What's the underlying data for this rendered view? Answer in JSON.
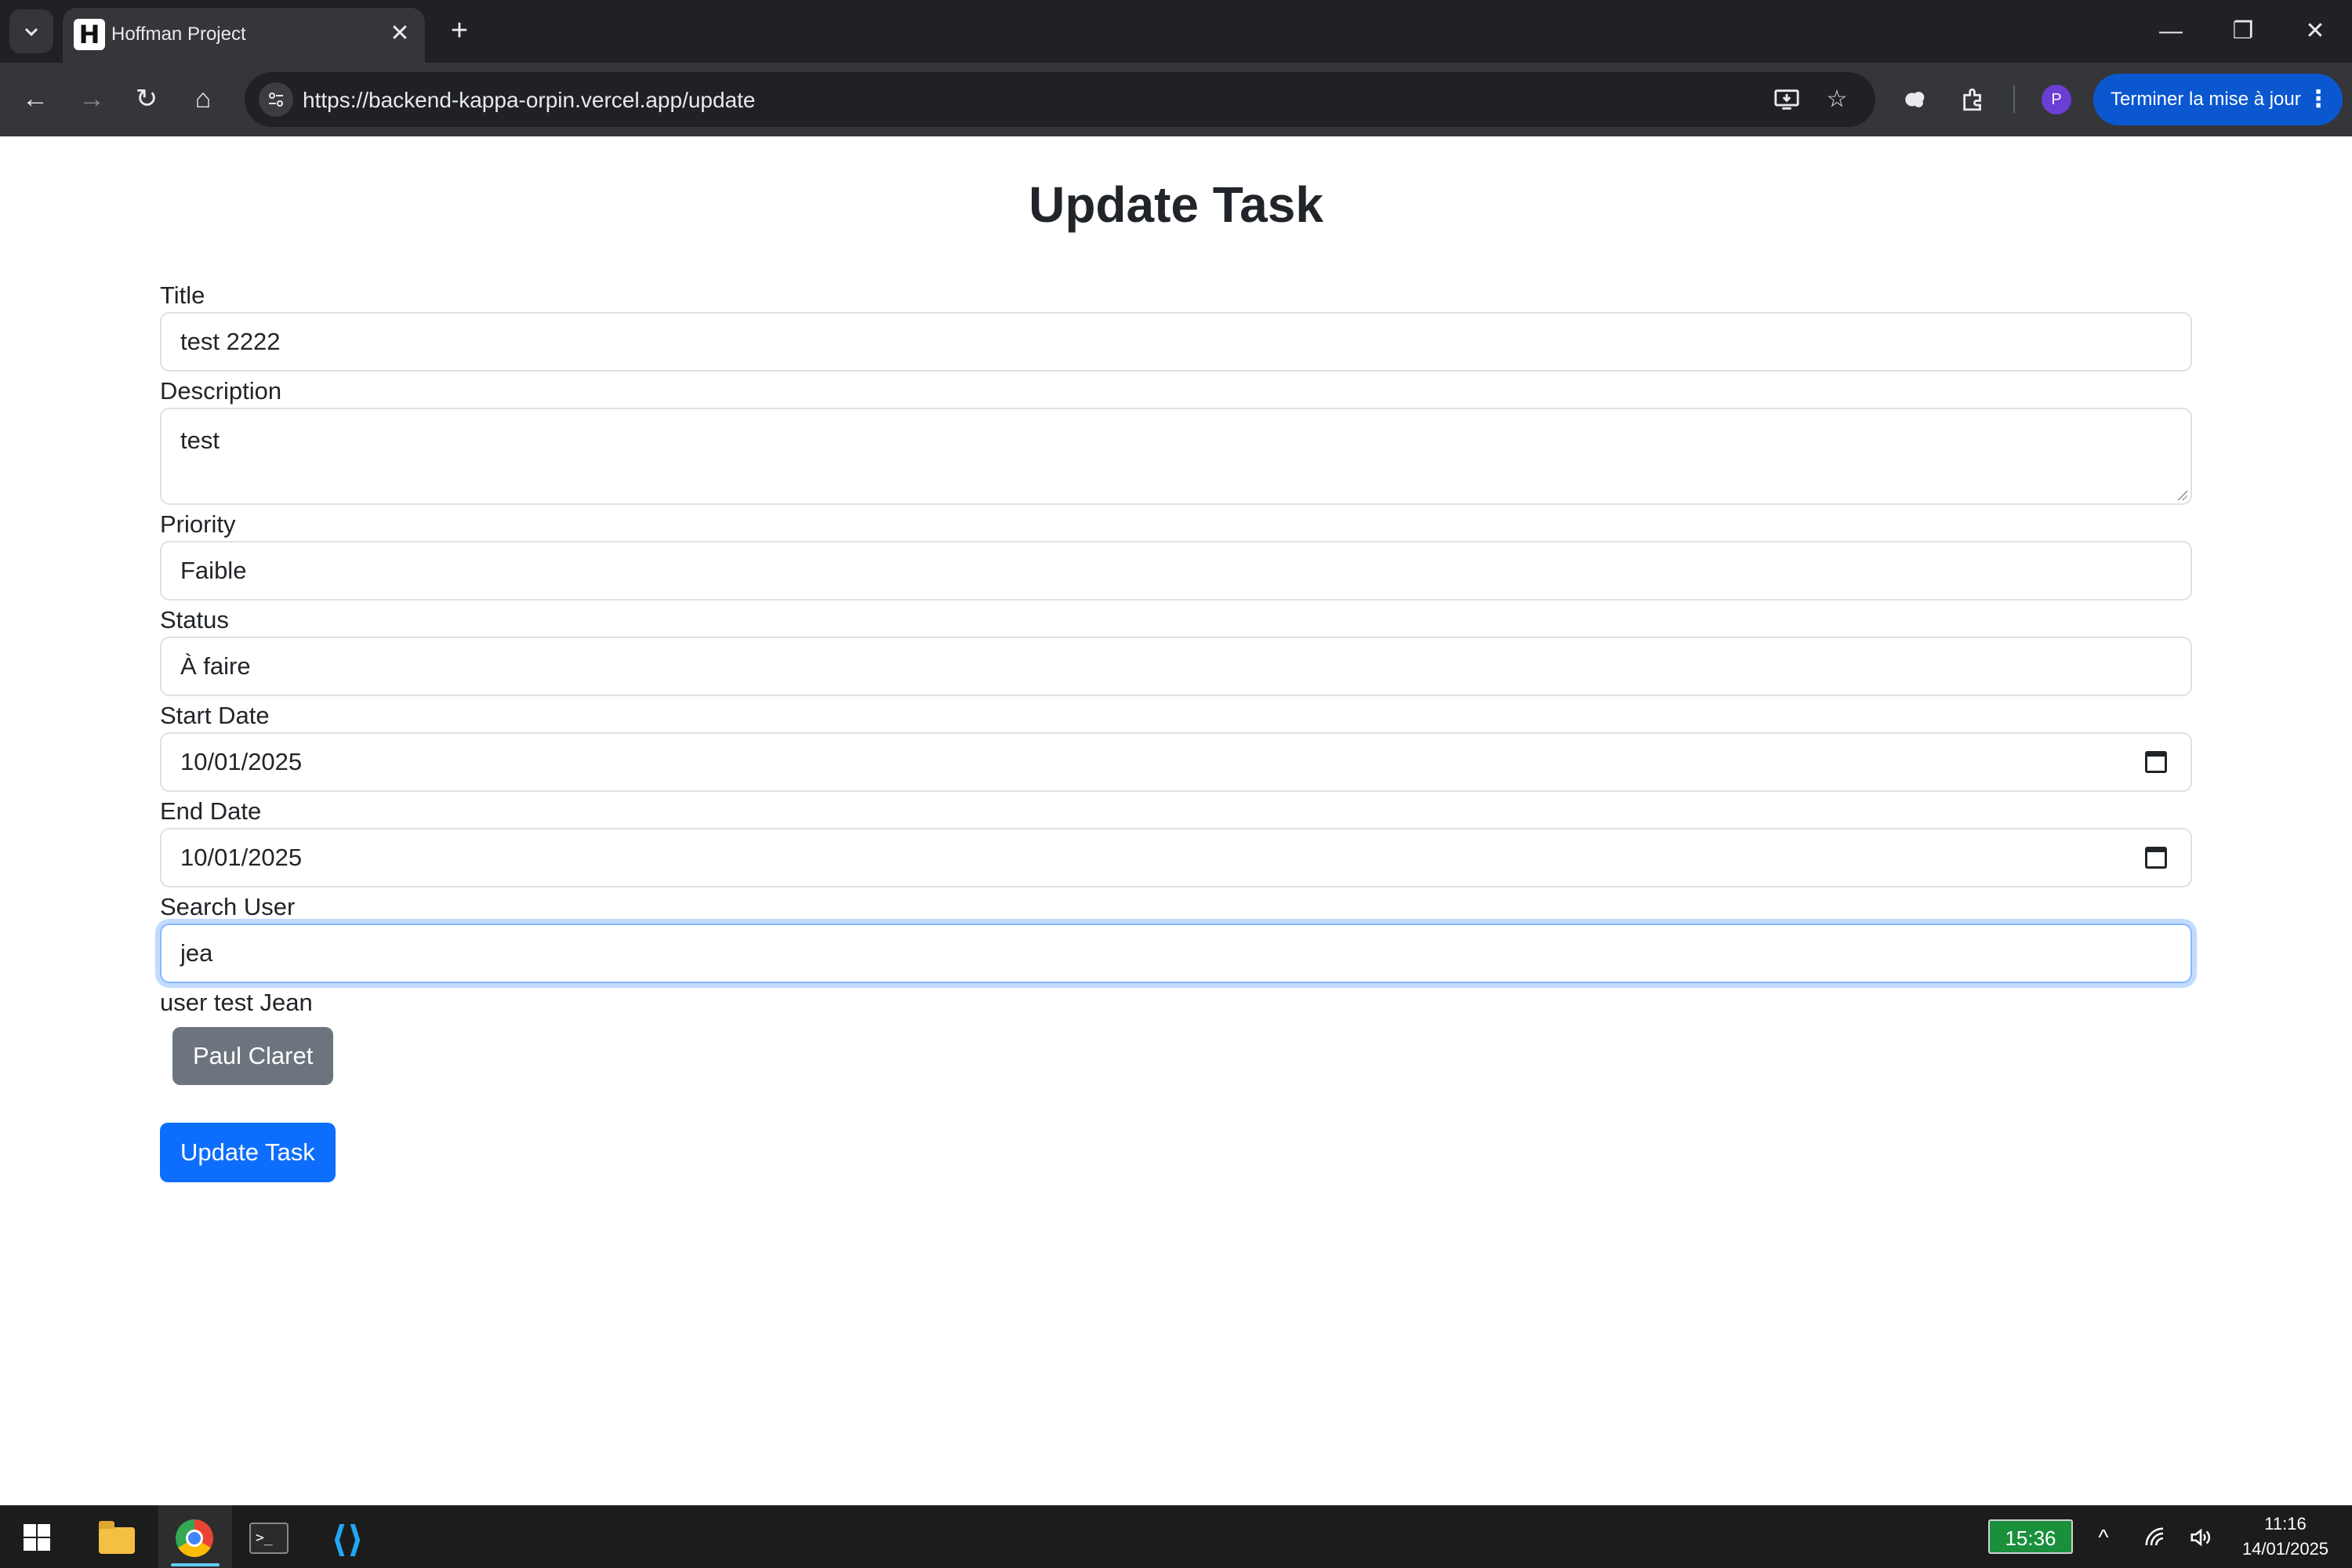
{
  "browser": {
    "tab": {
      "favicon_letter": "H",
      "title": "Hoffman Project",
      "close_glyph": "✕"
    },
    "new_tab_glyph": "+",
    "window_controls": {
      "minimize": "—",
      "restore": "❐",
      "close": "✕"
    },
    "toolbar": {
      "back": "←",
      "forward": "→",
      "reload": "↻",
      "home": "⌂",
      "url": "https://backend-kappa-orpin.vercel.app/update",
      "profile_initial": "P",
      "update_button": "Terminer la mise à jour",
      "menu_glyph": "⋮"
    }
  },
  "page": {
    "title": "Update Task",
    "fields": {
      "title": {
        "label": "Title",
        "value": "test 2222"
      },
      "description": {
        "label": "Description",
        "value": "test"
      },
      "priority": {
        "label": "Priority",
        "value": "Faible"
      },
      "status": {
        "label": "Status",
        "value": "À faire"
      },
      "start_date": {
        "label": "Start Date",
        "value": "10/01/2025"
      },
      "end_date": {
        "label": "End Date",
        "value": "10/01/2025"
      },
      "search_user": {
        "label": "Search User",
        "value": "jea"
      }
    },
    "search_results": [
      "user test Jean"
    ],
    "assigned_user_button": "Paul Claret",
    "submit_label": "Update Task"
  },
  "taskbar": {
    "battery_time": "15:36",
    "tray_chevron": "^",
    "clock_time": "11:16",
    "clock_date": "14/01/2025"
  },
  "colors": {
    "primary": "#0d6efd",
    "secondary": "#6c757d",
    "focus_ring": "#86b7fe",
    "chrome_dark": "#202124",
    "update_chip": "#0b57d0"
  }
}
